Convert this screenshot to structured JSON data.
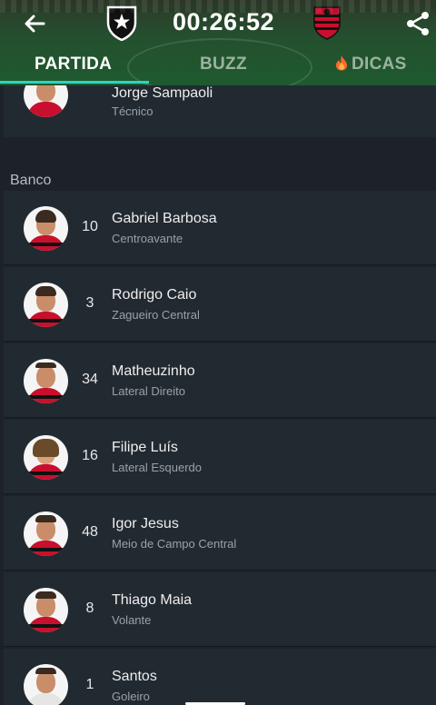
{
  "header": {
    "timer": "00:26:52",
    "home_club_icon": "botafogo-crest-icon",
    "away_club_icon": "flamengo-crest-icon"
  },
  "tabs": [
    {
      "label": "PARTIDA",
      "active": true
    },
    {
      "label": "BUZZ",
      "active": false
    },
    {
      "label": "DICAS",
      "active": false,
      "icon": "flame-icon"
    }
  ],
  "coach": {
    "name": "Jorge Sampaoli",
    "role": "Técnico"
  },
  "bench": {
    "label": "Banco",
    "players": [
      {
        "number": "10",
        "name": "Gabriel Barbosa",
        "position": "Centroavante"
      },
      {
        "number": "3",
        "name": "Rodrigo Caio",
        "position": "Zagueiro Central"
      },
      {
        "number": "34",
        "name": "Matheuzinho",
        "position": "Lateral Direito"
      },
      {
        "number": "16",
        "name": "Filipe Luís",
        "position": "Lateral Esquerdo"
      },
      {
        "number": "48",
        "name": "Igor Jesus",
        "position": "Meio de Campo Central"
      },
      {
        "number": "8",
        "name": "Thiago Maia",
        "position": "Volante"
      },
      {
        "number": "1",
        "name": "Santos",
        "position": "Goleiro"
      }
    ]
  },
  "colors": {
    "accent": "#2dd4bf",
    "background": "#1c2228",
    "row": "#222a31",
    "flamengo_red": "#c8102e"
  }
}
